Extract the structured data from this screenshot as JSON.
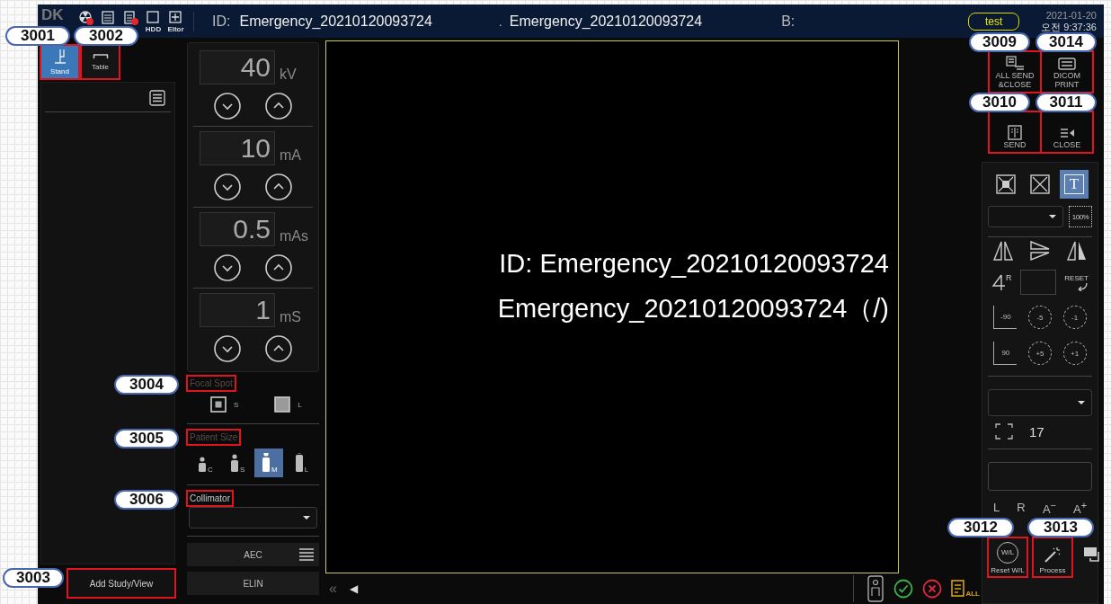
{
  "top_bar": {
    "logo": "DK",
    "status_icons": [
      {
        "kind": "radiation",
        "alert": true
      },
      {
        "kind": "list",
        "alert": false
      },
      {
        "kind": "document",
        "alert": true
      },
      {
        "kind": "square",
        "label": "HDD",
        "alert": false
      },
      {
        "kind": "plus",
        "label": "Eltor",
        "alert": false
      }
    ],
    "id_label": "ID:",
    "id_value": "Emergency_20210120093724",
    "separator": ".",
    "name_value": "Emergency_20210120093724",
    "b_label": "B:",
    "user": "test",
    "date": "2021-01-20",
    "time": "오전 9:37:36"
  },
  "positions": [
    {
      "kind": "stand",
      "label": "Stand",
      "selected": true,
      "callout": "3001"
    },
    {
      "kind": "table",
      "label": "Table",
      "selected": false,
      "callout": "3002"
    }
  ],
  "add_study": {
    "label": "Add Study/View",
    "callout": "3003"
  },
  "exposure": [
    {
      "value": "40",
      "unit": "kV"
    },
    {
      "value": "10",
      "unit": "mA"
    },
    {
      "value": "0.5",
      "unit": "mAs"
    },
    {
      "value": "1",
      "unit": "mS"
    }
  ],
  "focal_spot": {
    "title": "Focal Spot",
    "callout": "3004",
    "options": [
      {
        "label": "S",
        "selected": true
      },
      {
        "label": "L",
        "selected": false
      }
    ]
  },
  "patient_size": {
    "title": "Patient Size",
    "callout": "3005",
    "options": [
      {
        "label": "C",
        "selected": false
      },
      {
        "label": "S",
        "selected": false
      },
      {
        "label": "M",
        "selected": true
      },
      {
        "label": "L",
        "selected": false
      }
    ]
  },
  "collimator": {
    "title": "Collimator",
    "callout": "3006"
  },
  "aec": {
    "label": "AEC"
  },
  "elin": {
    "label": "ELIN"
  },
  "viewer": {
    "lines": [
      "ID: Emergency_20210120093724",
      "Emergency_20210120093724（/)"
    ]
  },
  "bottom_bar": {
    "collapse": "«",
    "previous": "◀",
    "all_label": "ALL"
  },
  "actions": [
    {
      "kind": "all-send",
      "label": "ALL SEND &CLOSE",
      "callout": "3009"
    },
    {
      "kind": "print",
      "label": "DICOM PRINT",
      "callout": "3014"
    },
    {
      "kind": "send",
      "label": "SEND",
      "callout": "3010"
    },
    {
      "kind": "close",
      "label": "CLOSE",
      "callout": "3011"
    }
  ],
  "tools": {
    "view_modes": [
      {
        "kind": "fit",
        "selected": false
      },
      {
        "kind": "fit-x",
        "selected": false
      },
      {
        "kind": "text",
        "label": "T",
        "selected": true
      }
    ],
    "zoom_label": "100%",
    "orientation_label": "R",
    "reset_label": "RESET",
    "rotations": [
      {
        "kind": "quarter-ccw",
        "label": "-90"
      },
      {
        "kind": "ccw",
        "label": "-5"
      },
      {
        "kind": "ccw",
        "label": "-1"
      },
      {
        "kind": "quarter-cw",
        "label": "90"
      },
      {
        "kind": "cw",
        "label": "+5"
      },
      {
        "kind": "cw",
        "label": "+1"
      }
    ],
    "frame_value": "17",
    "markers": [
      "L",
      "R",
      "A$^{−}$",
      "A$^{+}$"
    ],
    "process": [
      {
        "kind": "reset-wl",
        "icon_label": "W/L",
        "label": "Reset W/L",
        "callout": "3012"
      },
      {
        "kind": "process",
        "label": "Process",
        "callout": "3013"
      }
    ]
  }
}
